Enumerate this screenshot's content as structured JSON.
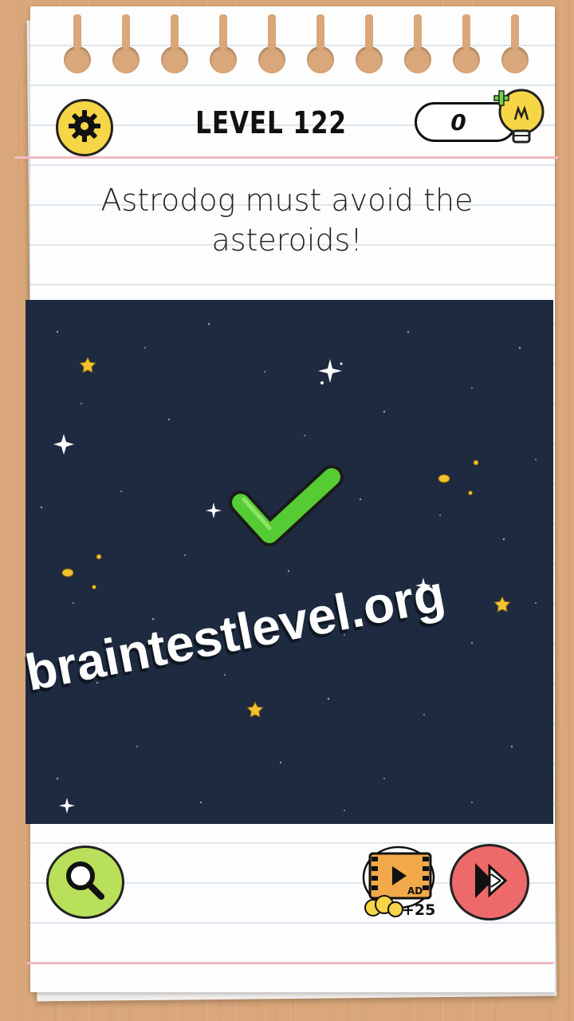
{
  "header": {
    "level_title": "LEVEL 122",
    "hint_count": "0"
  },
  "puzzle": {
    "question": "Astrodog must avoid the asteroids!"
  },
  "watermark": {
    "text": "braintestlevel.org"
  },
  "bottom_bar": {
    "ad_label": "AD",
    "ad_bonus": "+25"
  },
  "colors": {
    "background_wood": "#d9a77a",
    "space": "#1d2a3f",
    "settings_button": "#f6d547",
    "search_button": "#b8e05a",
    "skip_button": "#ee6a6a",
    "checkmark": "#55cc33",
    "header_rule": "#f1b9c3"
  },
  "icons": {
    "settings": "gear-icon",
    "hint": "lightbulb-icon",
    "search": "magnifier-icon",
    "ad": "film-play-icon",
    "skip": "fast-forward-icon",
    "result": "checkmark-icon"
  }
}
